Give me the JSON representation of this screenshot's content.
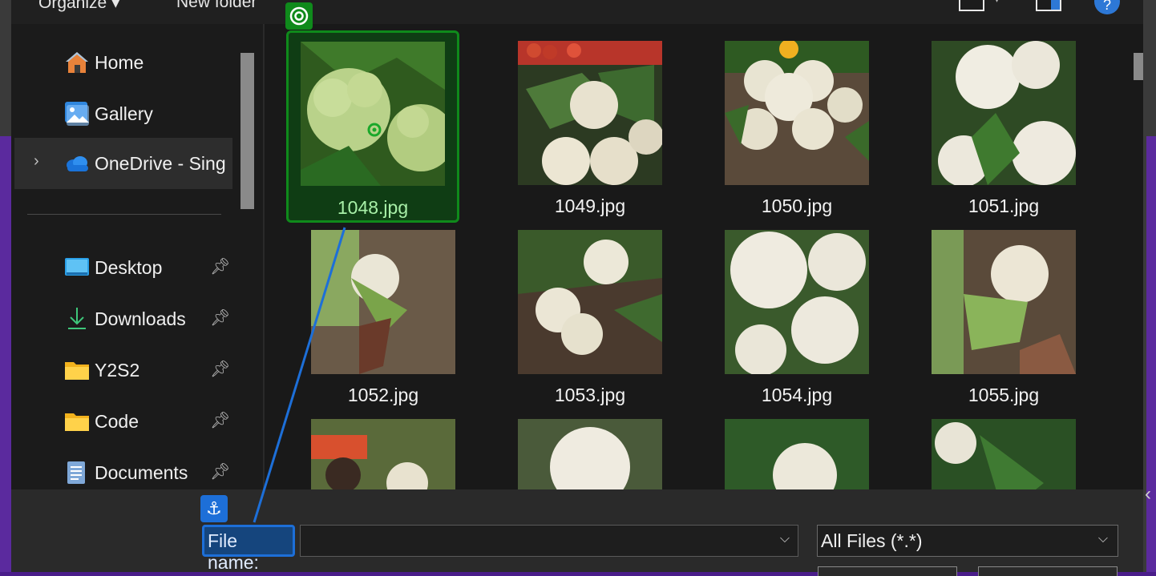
{
  "toolbar": {
    "organize_label": "Organize ▾",
    "new_folder_label": "New folder"
  },
  "sidebar": {
    "items": [
      {
        "label": "Home",
        "icon": "home-icon"
      },
      {
        "label": "Gallery",
        "icon": "gallery-icon"
      },
      {
        "label": "OneDrive - Sing",
        "icon": "onedrive-cloud-icon"
      },
      {
        "label": "Desktop",
        "icon": "desktop-icon",
        "pinned": true
      },
      {
        "label": "Downloads",
        "icon": "download-arrow-icon",
        "pinned": true
      },
      {
        "label": "Y2S2",
        "icon": "folder-icon",
        "pinned": true
      },
      {
        "label": "Code",
        "icon": "folder-icon",
        "pinned": true
      },
      {
        "label": "Documents",
        "icon": "document-icon",
        "pinned": true
      }
    ]
  },
  "files": [
    {
      "name": "1048.jpg",
      "selected": true
    },
    {
      "name": "1049.jpg"
    },
    {
      "name": "1050.jpg"
    },
    {
      "name": "1051.jpg"
    },
    {
      "name": "1052.jpg"
    },
    {
      "name": "1053.jpg"
    },
    {
      "name": "1054.jpg"
    },
    {
      "name": "1055.jpg"
    }
  ],
  "bottom": {
    "file_name_label": "File name:",
    "file_name_value": "",
    "filter_value": "All Files (*.*)"
  },
  "colors": {
    "selection_green": "#0f8a1b",
    "anchor_blue": "#1d6fd8",
    "accent_purple": "#5b2a9e"
  }
}
